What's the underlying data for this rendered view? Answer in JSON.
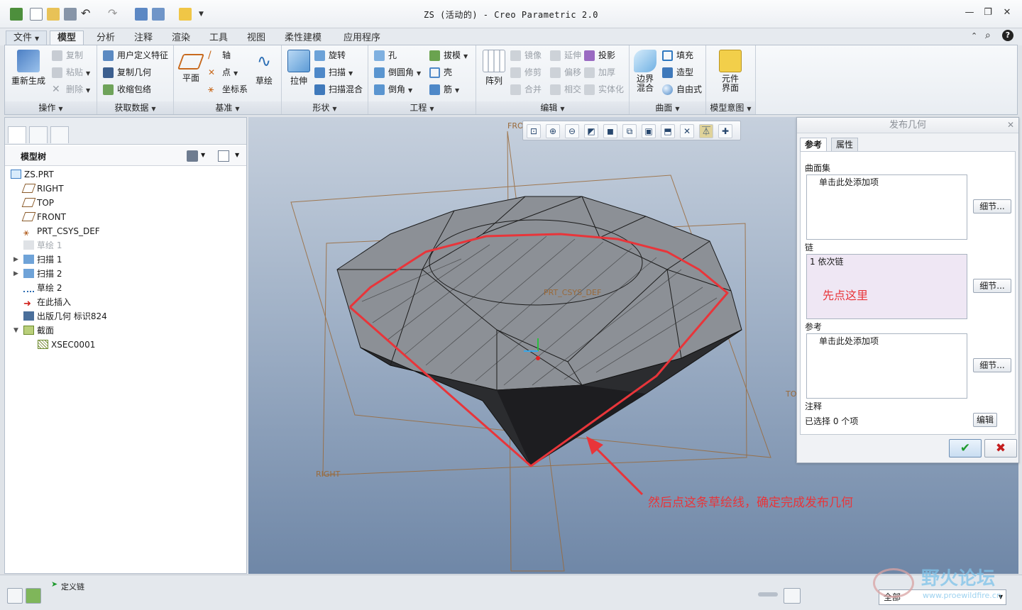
{
  "window": {
    "title": "ZS (活动的) - Creo Parametric 2.0",
    "controls": [
      "—",
      "❐",
      "✕"
    ]
  },
  "tabs": [
    {
      "label": "文件",
      "file": true
    },
    {
      "label": "模型",
      "active": true
    },
    {
      "label": "分析"
    },
    {
      "label": "注释"
    },
    {
      "label": "渲染"
    },
    {
      "label": "工具"
    },
    {
      "label": "视图"
    },
    {
      "label": "柔性建模"
    },
    {
      "label": "应用程序"
    }
  ],
  "ribbon": {
    "groups": {
      "operations": "操作",
      "get_data": "获取数据",
      "datum": "基准",
      "shapes": "形状",
      "engineering": "工程",
      "editing": "编辑",
      "surfaces": "曲面",
      "model_intent": "模型意图"
    },
    "regenerate": "重新生成",
    "copy": "复制",
    "paste": "粘贴",
    "delete": "删除",
    "udf": "用户定义特征",
    "copy_geom": "复制几何",
    "shrinkwrap": "收缩包络",
    "plane": "平面",
    "axis": "轴",
    "point": "点",
    "csys": "坐标系",
    "sketch": "草绘",
    "extrude": "拉伸",
    "revolve": "旋转",
    "sweep": "扫描",
    "swept_blend": "扫描混合",
    "hole": "孔",
    "round": "倒圆角",
    "chamfer": "倒角",
    "draft": "拔模",
    "shell": "壳",
    "rib": "筋",
    "pattern": "阵列",
    "mirror": "镜像",
    "trim": "修剪",
    "merge": "合并",
    "extend": "延伸",
    "offset": "偏移",
    "intersect": "相交",
    "project": "投影",
    "thicken": "加厚",
    "solidify": "实体化",
    "boundary_blend": "边界混合",
    "fill": "填充",
    "style": "造型",
    "freestyle": "自由式",
    "component_interface": "元件界面"
  },
  "model_tree": {
    "header": "模型树",
    "items": [
      {
        "label": "ZS.PRT"
      },
      {
        "label": "RIGHT"
      },
      {
        "label": "TOP"
      },
      {
        "label": "FRONT"
      },
      {
        "label": "PRT_CSYS_DEF"
      },
      {
        "label": "草绘 1",
        "dim": true
      },
      {
        "label": "扫描 1"
      },
      {
        "label": "扫描 2"
      },
      {
        "label": "草绘 2"
      },
      {
        "label": "在此插入"
      },
      {
        "label": "出版几何 标识824"
      },
      {
        "label": "截面"
      },
      {
        "label": "XSEC0001"
      }
    ]
  },
  "viewport": {
    "datum_labels": {
      "front": "FRO",
      "right": "RIGHT",
      "top": "TO",
      "csys": "PRT_CSYS_DEF"
    },
    "annotation": "然后点这条草绘线，确定完成发布几何",
    "colors": {
      "annotation": "#e8353a"
    }
  },
  "dialog": {
    "title": "发布几何",
    "tabs": [
      "参考",
      "属性"
    ],
    "surface_set_label": "曲面集",
    "surface_set_placeholder": "单击此处添加项",
    "chain_label": "链",
    "chain_item": "1 依次链",
    "chain_hint": "先点这里",
    "ref_label": "参考",
    "ref_placeholder": "单击此处添加项",
    "detail_btn": "细节...",
    "notes_label": "注释",
    "selected_text": "已选择 0 个项",
    "edit_btn": "编辑",
    "ok": "✔",
    "cancel": "✖"
  },
  "status": {
    "define_chain": "定义链",
    "filter": "全部",
    "watermark": "野火论坛",
    "watermark_url": "www.proewildfire.cn"
  }
}
